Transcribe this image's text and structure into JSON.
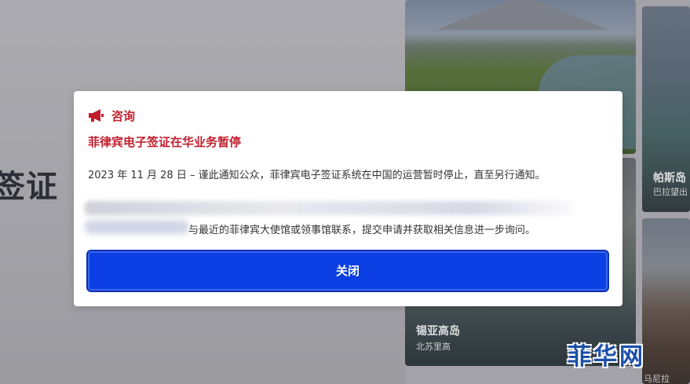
{
  "background": {
    "page_title": "签证",
    "destinations": [
      {
        "name": "帕斯岛",
        "region": "巴拉望出"
      },
      {
        "name": "锡亚高岛",
        "region": "北苏里高"
      },
      {
        "name": "",
        "region": "马尼拉"
      }
    ]
  },
  "watermark": {
    "text": "菲华网"
  },
  "modal": {
    "icon": "megaphone-icon",
    "label": "咨询",
    "title": "菲律宾电子签证在华业务暂停",
    "body_line1": "2023 年 11 月 28 日 – 谨此通知公众，菲律宾电子签证系统在中国的运营暂时停止，直至另行通知。",
    "body_line2_visible": "与最近的菲律宾大使馆或领事馆联系，提交申请并获取相关信息进一步询问。",
    "close_label": "关闭"
  },
  "colors": {
    "accent_red": "#c21f2e",
    "button_blue": "#0b3fe3",
    "watermark_blue": "#1c4fa8"
  }
}
